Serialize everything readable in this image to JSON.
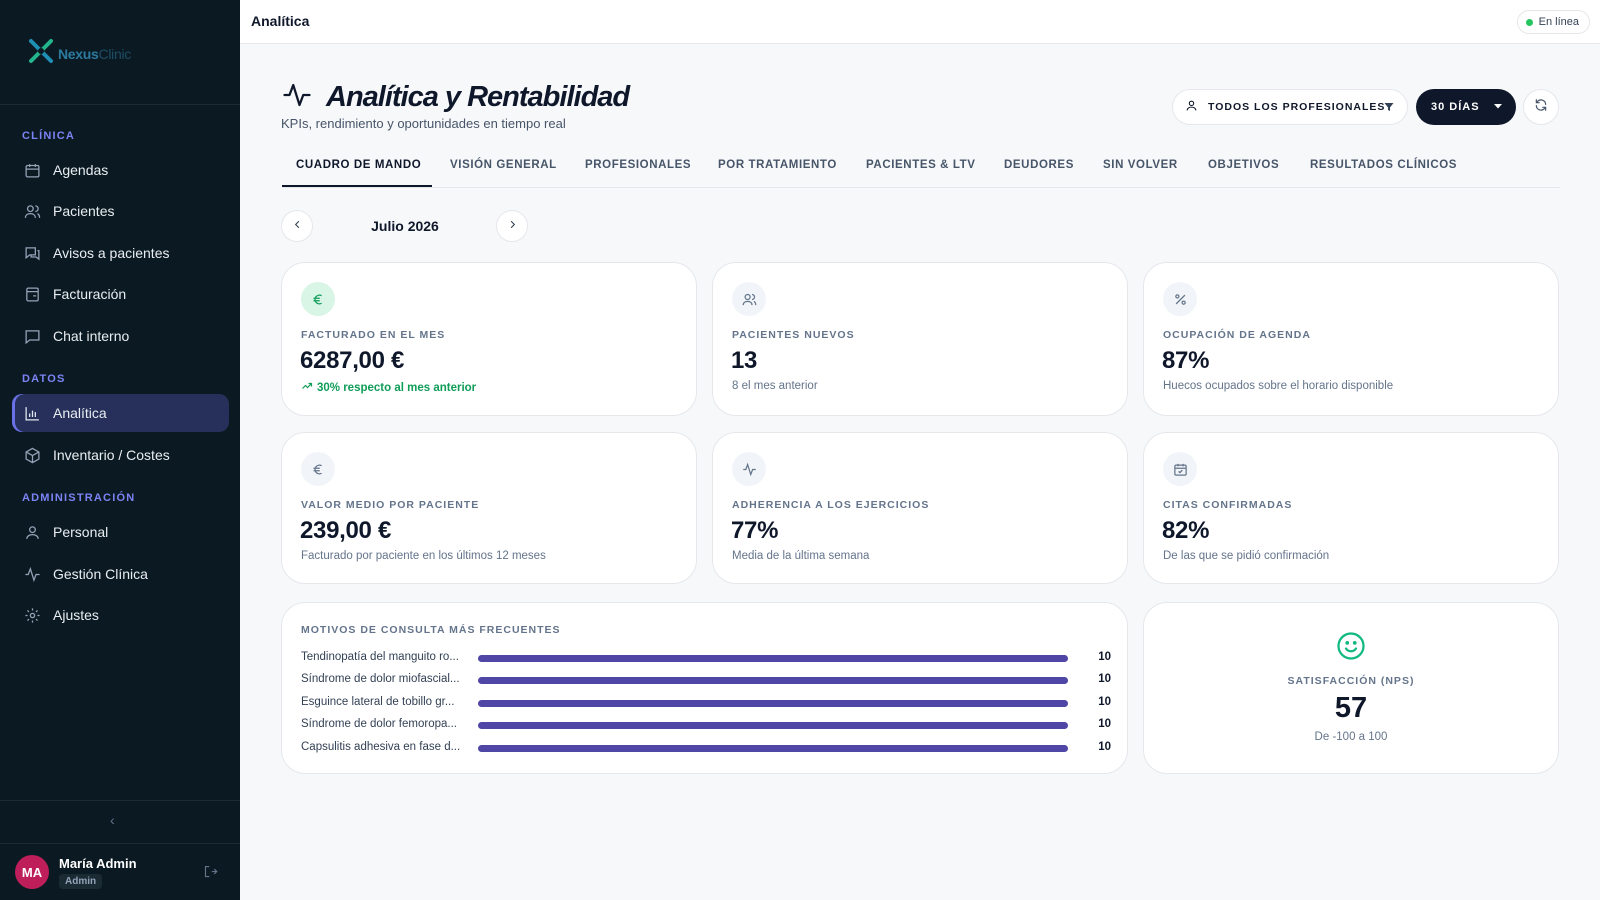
{
  "app": {
    "logo_nexus": "Nexus",
    "logo_clinic": "Clinic"
  },
  "sidebar": {
    "sections": [
      {
        "label": "CLÍNICA"
      },
      {
        "label": "DATOS"
      },
      {
        "label": "ADMINISTRACIÓN"
      }
    ],
    "items": [
      {
        "label": "Agendas",
        "icon": "calendar-icon"
      },
      {
        "label": "Pacientes",
        "icon": "users-icon"
      },
      {
        "label": "Avisos a pacientes",
        "icon": "messages-icon"
      },
      {
        "label": "Facturación",
        "icon": "invoice-icon"
      },
      {
        "label": "Chat interno",
        "icon": "chat-icon"
      },
      {
        "label": "Analítica",
        "icon": "bar-chart-icon",
        "active": true
      },
      {
        "label": "Inventario / Costes",
        "icon": "box-icon"
      },
      {
        "label": "Personal",
        "icon": "user-icon"
      },
      {
        "label": "Gestión Clínica",
        "icon": "activity-icon"
      },
      {
        "label": "Ajustes",
        "icon": "gear-icon"
      }
    ]
  },
  "user": {
    "initials": "MA",
    "name": "María Admin",
    "role": "Admin",
    "avatar_color": "#be1e5a"
  },
  "topbar": {
    "title": "Analítica",
    "status": "En línea"
  },
  "header": {
    "title": "Analítica y Rentabilidad",
    "subtitle": "KPIs, rendimiento y oportunidades en tiempo real",
    "filter_label": "TODOS LOS PROFESIONALES",
    "period_label": "30 DÍAS"
  },
  "tabs": [
    {
      "label": "CUADRO DE MANDO",
      "active": true
    },
    {
      "label": "VISIÓN GENERAL"
    },
    {
      "label": "PROFESIONALES"
    },
    {
      "label": "POR TRATAMIENTO"
    },
    {
      "label": "PACIENTES & LTV"
    },
    {
      "label": "DEUDORES"
    },
    {
      "label": "SIN VOLVER"
    },
    {
      "label": "OBJETIVOS"
    },
    {
      "label": "RESULTADOS CLÍNICOS"
    }
  ],
  "month": {
    "label": "Julio 2026"
  },
  "kpis": [
    {
      "label": "FACTURADO EN EL MES",
      "value": "6287,00 €",
      "note": "30% respecto al mes anterior",
      "icon": "euro-icon"
    },
    {
      "label": "PACIENTES NUEVOS",
      "value": "13",
      "note": "8 el mes anterior",
      "icon": "users-icon"
    },
    {
      "label": "OCUPACIÓN DE AGENDA",
      "value": "87%",
      "note": "Huecos ocupados sobre el horario disponible",
      "icon": "percent-icon"
    },
    {
      "label": "VALOR MEDIO POR PACIENTE",
      "value": "239,00 €",
      "note": "Facturado por paciente en los últimos 12 meses",
      "icon": "euro-icon"
    },
    {
      "label": "ADHERENCIA A LOS EJERCICIOS",
      "value": "77%",
      "note": "Media de la última semana",
      "icon": "activity-icon"
    },
    {
      "label": "CITAS CONFIRMADAS",
      "value": "82%",
      "note": "De las que se pidió confirmación",
      "icon": "calendar-check-icon"
    }
  ],
  "reasons": {
    "title": "MOTIVOS DE CONSULTA MÁS FRECUENTES",
    "max": 10,
    "items": [
      {
        "label": "Tendinopatía del manguito ro...",
        "value": 10
      },
      {
        "label": "Síndrome de dolor miofascial...",
        "value": 10
      },
      {
        "label": "Esguince lateral de tobillo gr...",
        "value": 10
      },
      {
        "label": "Síndrome de dolor femoropa...",
        "value": 10
      },
      {
        "label": "Capsulitis adhesiva en fase d...",
        "value": 10
      }
    ]
  },
  "nps": {
    "label": "SATISFACCIÓN (NPS)",
    "value": "57",
    "note": "De -100 a 100",
    "icon": "smile-icon"
  },
  "colors": {
    "accent": "#4f46a5",
    "positive": "#0f9d58",
    "sidebar_bg": "#0b1a22",
    "active_item": "#26305a"
  }
}
